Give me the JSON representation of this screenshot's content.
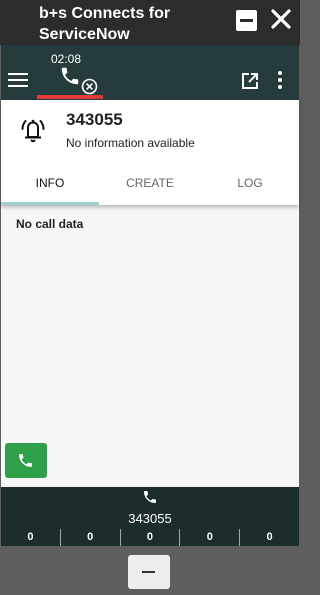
{
  "window": {
    "title": "b+s Connects for ServiceNow",
    "minimize_icon": "minimize-icon",
    "close_icon": "close-icon"
  },
  "toolbar": {
    "menu_icon": "hamburger-menu-icon",
    "call_timer": "02:08",
    "call_icon": "phone-icon",
    "call_end_icon": "circle-x-icon",
    "popout_icon": "open-external-icon",
    "more_icon": "more-vertical-icon"
  },
  "caller": {
    "icon": "bell-icon",
    "number": "343055",
    "info": "No information available"
  },
  "tabs": [
    {
      "label": "INFO",
      "active": true
    },
    {
      "label": "CREATE",
      "active": false
    },
    {
      "label": "LOG",
      "active": false
    }
  ],
  "content": {
    "message": "No call data"
  },
  "actions": {
    "dial_icon": "phone-icon"
  },
  "footer": {
    "icon": "phone-icon",
    "number": "343055",
    "counters": [
      "0",
      "0",
      "0",
      "0",
      "0"
    ]
  },
  "restore": {
    "icon": "minus-icon"
  },
  "colors": {
    "titlebar": "#2c2c2c",
    "toolbar": "#263c3c",
    "active_call_underline": "#e23a3a",
    "tab_indicator": "#9ed1cd",
    "dial_button": "#2ea04a",
    "footer": "#1d2d2d"
  }
}
